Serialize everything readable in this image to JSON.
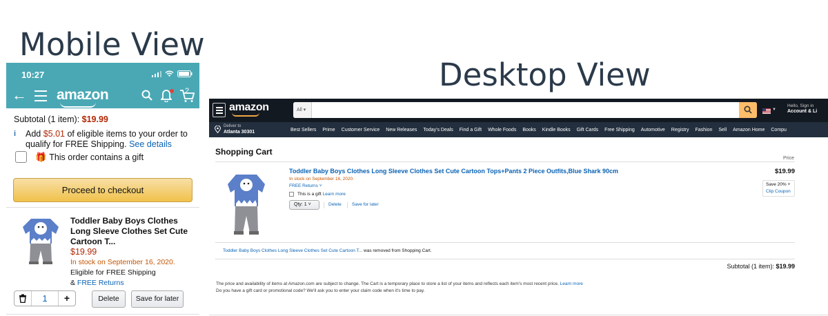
{
  "titles": {
    "mobile": "Mobile View",
    "desktop": "Desktop View"
  },
  "colors": {
    "mobile_header": "#4aa8b5",
    "desktop_header": "#131921",
    "desktop_nav": "#232f3e",
    "price_red": "#b12704",
    "link_blue": "#0b63b4",
    "stock_orange": "#c45500",
    "checkout_yellow": "#f0c14b"
  },
  "mobile": {
    "status_time": "10:27",
    "logo": "amazon",
    "cart_count": "2",
    "subtotal_label": "Subtotal (1 item): ",
    "subtotal_price": "$19.99",
    "shipping_info_icon": "i",
    "shipping_pre": "Add ",
    "shipping_amount": "$5.01",
    "shipping_post": " of eligible items to your order to qualify for FREE Shipping. ",
    "see_details": "See details",
    "gift_label": "This order contains a gift",
    "checkout_button": "Proceed to checkout",
    "item": {
      "title": "Toddler Baby Boys Clothes Long Sleeve Clothes Set Cute Cartoon T...",
      "price": "$19.99",
      "stock": "In stock on September 16, 2020.",
      "eligible": "Eligible for FREE Shipping",
      "returns_prefix": "& ",
      "returns_link": "FREE Returns"
    },
    "qty": {
      "value": "1",
      "plus": "+"
    },
    "delete_button": "Delete",
    "save_button": "Save for later"
  },
  "desktop": {
    "logo": "amazon",
    "search_category": "All",
    "hello": "Hello, Sign in",
    "account": "Account & Li",
    "deliver_to": "Deliver to",
    "deliver_location": "Atlanta 30301",
    "nav_links": [
      "Best Sellers",
      "Prime",
      "Customer Service",
      "New Releases",
      "Today's Deals",
      "Find a Gift",
      "Whole Foods",
      "Books",
      "Kindle Books",
      "Gift Cards",
      "Free Shipping",
      "Automotive",
      "Registry",
      "Fashion",
      "Sell",
      "Amazon Home",
      "Compu"
    ],
    "cart_heading": "Shopping Cart",
    "price_label": "Price",
    "item": {
      "title": "Toddler Baby Boys Clothes Long Sleeve Clothes Set Cute Cartoon Tops+Pants 2 Piece Outfits,Blue Shark 90cm",
      "stock": "In stock on September 16, 2020.",
      "returns": "FREE Returns",
      "gift_label": "This is a gift",
      "gift_link": "Learn more",
      "qty": "Qty:  1",
      "delete": "Delete",
      "save": "Save for later",
      "price": "$19.99",
      "coupon_save": "Save 20%",
      "coupon_clip": "Clip Coupon"
    },
    "removed_link": "Toddler Baby Boys Clothes Long Sleeve Clothes Set Cute Cartoon T...",
    "removed_text": " was removed from Shopping Cart.",
    "subtotal_label": "Subtotal (1 item): ",
    "subtotal_price": "$19.99",
    "disclaimer_line1": "The price and availability of items at Amazon.com are subject to change. The Cart is a temporary place to store a list of your items and reflects each item's most recent price. ",
    "disclaimer_link": "Learn more",
    "disclaimer_line2": "Do you have a gift card or promotional code? We'll ask you to enter your claim code when it's time to pay."
  }
}
